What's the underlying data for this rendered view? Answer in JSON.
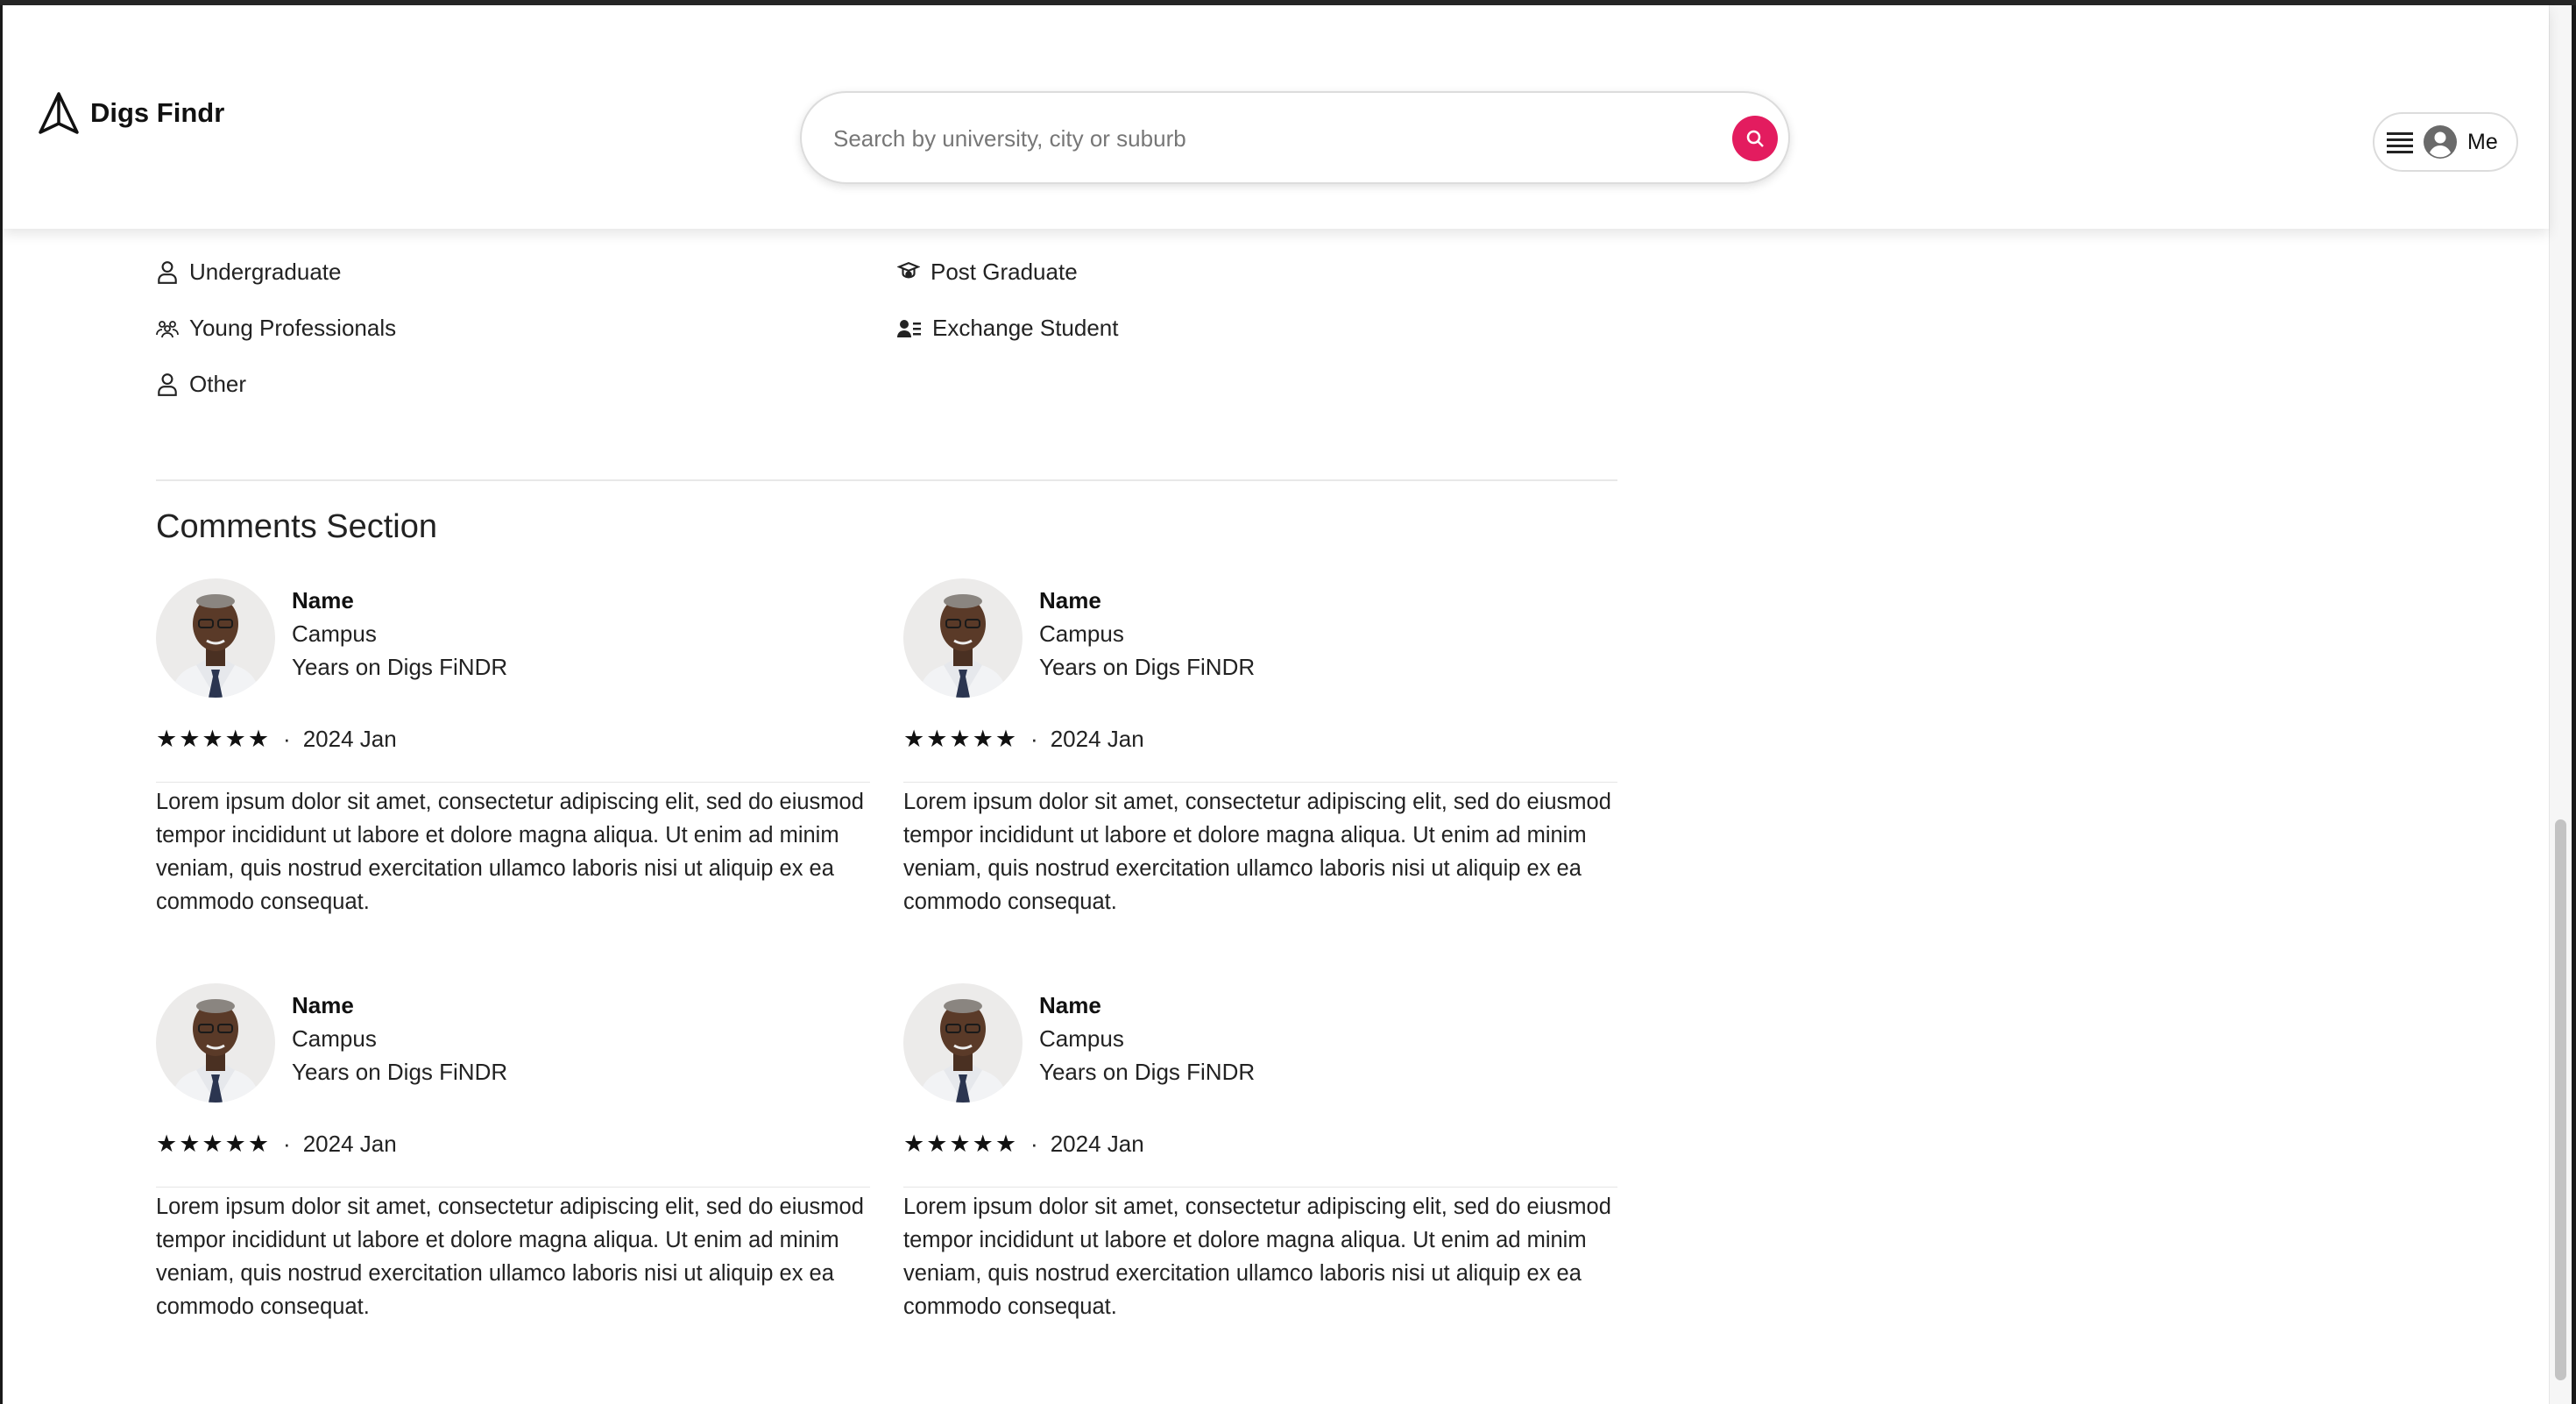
{
  "header": {
    "brand": "Digs Findr",
    "search_placeholder": "Search by university, city or suburb",
    "user_label": "Me",
    "accent_color": "#e31c5f"
  },
  "tenant_types": [
    {
      "label": "Undergraduate",
      "icon": "person-icon"
    },
    {
      "label": "Post Graduate",
      "icon": "graduation-cap-icon"
    },
    {
      "label": "Young Professionals",
      "icon": "people-group-icon"
    },
    {
      "label": "Exchange Student",
      "icon": "id-card-icon"
    },
    {
      "label": "Other",
      "icon": "person-icon"
    }
  ],
  "comments_section": {
    "title": "Comments Section",
    "comments": [
      {
        "name": "Name",
        "campus": "Campus",
        "years": "Years on Digs FiNDR",
        "stars": "★★★★★",
        "rating": 5,
        "separator": "·",
        "date": "2024 Jan",
        "text": "Lorem ipsum dolor sit amet, consectetur adipiscing elit, sed do eiusmod tempor incididunt ut labore et dolore magna aliqua. Ut enim ad minim veniam, quis nostrud exercitation ullamco laboris nisi ut aliquip ex ea commodo consequat."
      },
      {
        "name": "Name",
        "campus": "Campus",
        "years": "Years on Digs FiNDR",
        "stars": "★★★★★",
        "rating": 5,
        "separator": "·",
        "date": "2024 Jan",
        "text": "Lorem ipsum dolor sit amet, consectetur adipiscing elit, sed do eiusmod tempor incididunt ut labore et dolore magna aliqua. Ut enim ad minim veniam, quis nostrud exercitation ullamco laboris nisi ut aliquip ex ea commodo consequat."
      },
      {
        "name": "Name",
        "campus": "Campus",
        "years": "Years on Digs FiNDR",
        "stars": "★★★★★",
        "rating": 5,
        "separator": "·",
        "date": "2024 Jan",
        "text": "Lorem ipsum dolor sit amet, consectetur adipiscing elit, sed do eiusmod tempor incididunt ut labore et dolore magna aliqua. Ut enim ad minim veniam, quis nostrud exercitation ullamco laboris nisi ut aliquip ex ea commodo consequat."
      },
      {
        "name": "Name",
        "campus": "Campus",
        "years": "Years on Digs FiNDR",
        "stars": "★★★★★",
        "rating": 5,
        "separator": "·",
        "date": "2024 Jan",
        "text": "Lorem ipsum dolor sit amet, consectetur adipiscing elit, sed do eiusmod tempor incididunt ut labore et dolore magna aliqua. Ut enim ad minim veniam, quis nostrud exercitation ullamco laboris nisi ut aliquip ex ea commodo consequat."
      }
    ]
  }
}
